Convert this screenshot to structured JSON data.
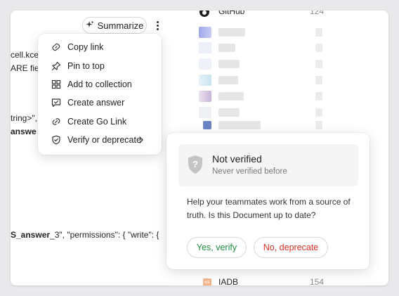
{
  "toolbar": {
    "summarize_label": "Summarize",
    "more_icon": "more-vertical-icon"
  },
  "document": {
    "line1": "cell.kce",
    "line2": "ARE fie",
    "line3": "tring>\",",
    "line4": "answe",
    "line5_bold": "S_answer",
    "line5_rest": "_3\", \"permissions\": { \"write\": {"
  },
  "menu": {
    "items": [
      {
        "label": "Copy link",
        "icon": "link-icon"
      },
      {
        "label": "Pin to top",
        "icon": "pin-icon"
      },
      {
        "label": "Add to collection",
        "icon": "grid-icon"
      },
      {
        "label": "Create answer",
        "icon": "answer-icon"
      },
      {
        "label": "Create Go Link",
        "icon": "go-link-icon"
      },
      {
        "label": "Verify or deprecate",
        "icon": "shield-check-icon"
      }
    ]
  },
  "list": {
    "top_label": "GitHub",
    "top_count": "124",
    "bottom_label": "IADB",
    "bottom_count": "154",
    "bottom_icon_text": "WE"
  },
  "verify": {
    "title": "Not verified",
    "subtitle": "Never verified before",
    "body": "Help your teammates work from a source of truth. Is this Document up to date?",
    "yes_label": "Yes, verify",
    "no_label": "No, deprecate"
  },
  "colors": {
    "yes": "#1e8e3e",
    "no": "#d93025",
    "accent_blur": "#a8b0ee"
  }
}
